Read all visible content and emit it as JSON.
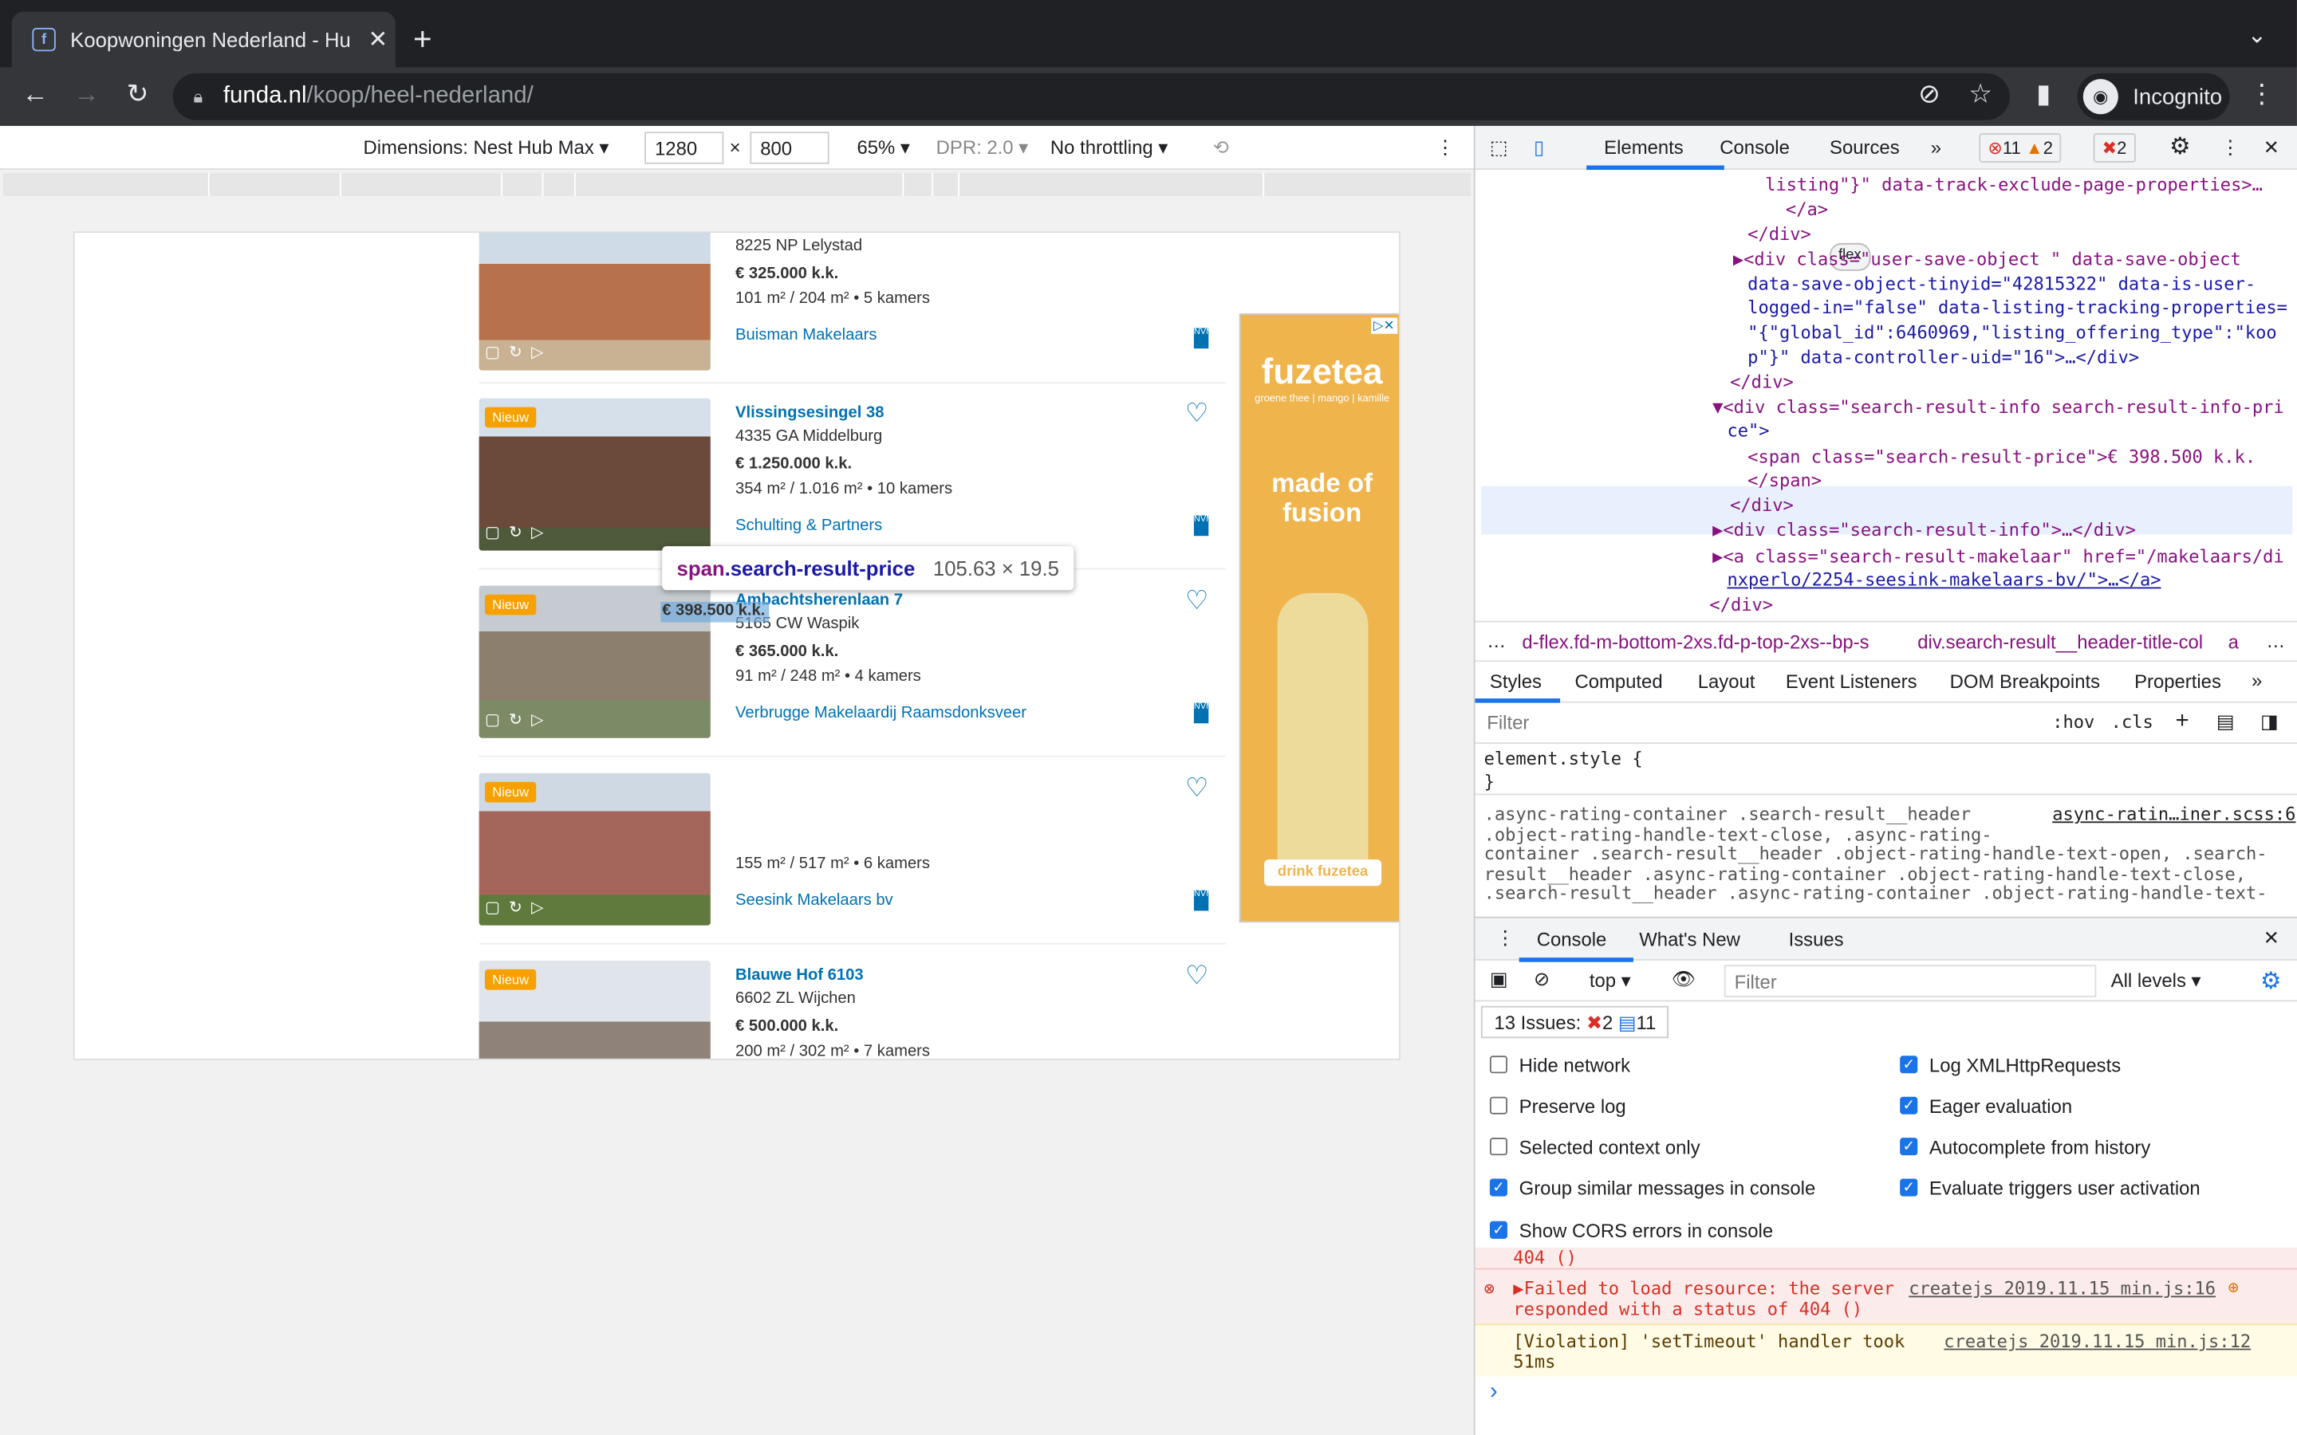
{
  "browser": {
    "tab_title": "Koopwoningen Nederland - Hu",
    "url_domain": "funda.nl",
    "url_path": "/koop/heel-nederland/",
    "incognito_label": "Incognito"
  },
  "device": {
    "dimensions": "Dimensions: Nest Hub Max",
    "width": "1280",
    "height": "800",
    "zoom": "65%",
    "dpr": "DPR: 2.0",
    "throttling": "No throttling",
    "x_sep": "×"
  },
  "listings": [
    {
      "address": "",
      "postcode": "8225 NP Lelystad",
      "price": "€ 325.000 k.k.",
      "size": "101 m² / 204 m² • 5 kamers",
      "makelaar": "Buisman Makelaars",
      "badge": ""
    },
    {
      "address": "Vlissingsesingel 38",
      "postcode": "4335 GA Middelburg",
      "price": "€ 1.250.000 k.k.",
      "size": "354 m² / 1.016 m² • 10 kamers",
      "makelaar": "Schulting & Partners",
      "badge": "Nieuw"
    },
    {
      "address": "Ambachtsherenlaan 7",
      "postcode": "5165 CW Waspik",
      "price": "€ 365.000 k.k.",
      "size": "91 m² / 248 m² • 4 kamers",
      "makelaar": "Verbrugge Makelaardij Raamsdonksveer",
      "badge": "Nieuw"
    },
    {
      "address": "",
      "postcode": "",
      "price": "€ 398.500 k.k.",
      "size": "155 m² / 517 m² • 6 kamers",
      "makelaar": "Seesink Makelaars bv",
      "badge": "Nieuw"
    },
    {
      "address": "Blauwe Hof 6103",
      "postcode": "6602 ZL Wijchen",
      "price": "€ 500.000 k.k.",
      "size": "200 m² / 302 m² • 7 kamers",
      "makelaar": "",
      "badge": "Nieuw"
    }
  ],
  "ad": {
    "brand": "fuzetea",
    "sub": "groene thee | mango | kamille",
    "made": "made of fusion",
    "cta": "drink fuzetea"
  },
  "tooltip": {
    "tag": "span",
    "cls": ".search-result-price",
    "dims": "105.63 × 19.5"
  },
  "devtools": {
    "tabs": [
      "Elements",
      "Console",
      "Sources"
    ],
    "errors": "11",
    "warnings": "2",
    "issues_badge": "2",
    "elements_lines": [
      "listing\"}\" data-track-exclude-page-properties>…",
      "</a>",
      "</div>",
      "▶<div class=\"user-save-object \" data-save-object",
      "data-save-object-tinyid=\"42815322\" data-is-user-",
      "logged-in=\"false\" data-listing-tracking-properties=",
      "\"{\"global_id\":6460969,\"listing_offering_type\":\"koo",
      "p\"}\" data-controller-uid=\"16\">…</div>",
      "</div>",
      "▼<div class=\"search-result-info search-result-info-pri",
      "ce\">",
      "<span class=\"search-result-price\">€ 398.500 k.k.",
      "</span>",
      "</div>",
      "▶<div class=\"search-result-info\">…</div>",
      "▶<a class=\"search-result-makelaar\" href=\"/makelaars/di",
      "nxperlo/2254-seesink-makelaars-bv/\">…</a>",
      "</div>"
    ],
    "flex_badge": "flex",
    "crumb1": "d-flex.fd-m-bottom-2xs.fd-p-top-2xs--bp-s",
    "crumb2": "div.search-result__header-title-col",
    "crumb3": "a",
    "style_tabs": [
      "Styles",
      "Computed",
      "Layout",
      "Event Listeners",
      "DOM Breakpoints",
      "Properties"
    ],
    "filter_placeholder": "Filter",
    "hov": ":hov",
    "cls": ".cls",
    "element_style": "element.style {",
    "close_brace": "}",
    "rule_source": "async-ratin…iner.scss:6",
    "rule_lines": [
      ".async-rating-container .search-result__header",
      ".object-rating-handle-text-close, .async-rating-",
      "container .search-result__header .object-rating-handle-text-open, .search-",
      "result__header .async-rating-container .object-rating-handle-text-close,",
      ".search-result__header .async-rating-container .object-rating-handle-text-"
    ],
    "drawer_tabs": [
      "Console",
      "What's New",
      "Issues"
    ],
    "context": "top",
    "console_filter": "Filter",
    "levels": "All levels",
    "issues_label": "13 Issues:",
    "issues_err": "2",
    "issues_info": "11",
    "settings_left": [
      "Hide network",
      "Preserve log",
      "Selected context only",
      "Group similar messages in console",
      "Show CORS errors in console"
    ],
    "settings_left_checked": [
      false,
      false,
      false,
      true,
      true
    ],
    "settings_right": [
      "Log XMLHttpRequests",
      "Eager evaluation",
      "Autocomplete from history",
      "Evaluate triggers user activation"
    ],
    "settings_right_checked": [
      true,
      true,
      true,
      true
    ],
    "log_404": "404 ()",
    "log_err1": "▶Failed to load resource: the server",
    "log_err2": "responded with a status of 404 ()",
    "log_err_src": "createjs 2019.11.15 min.js:16",
    "log_warn1": "[Violation] 'setTimeout' handler took",
    "log_warn2": "51ms",
    "log_warn_src": "createjs 2019.11.15 min.js:12",
    "prompt": "›"
  }
}
